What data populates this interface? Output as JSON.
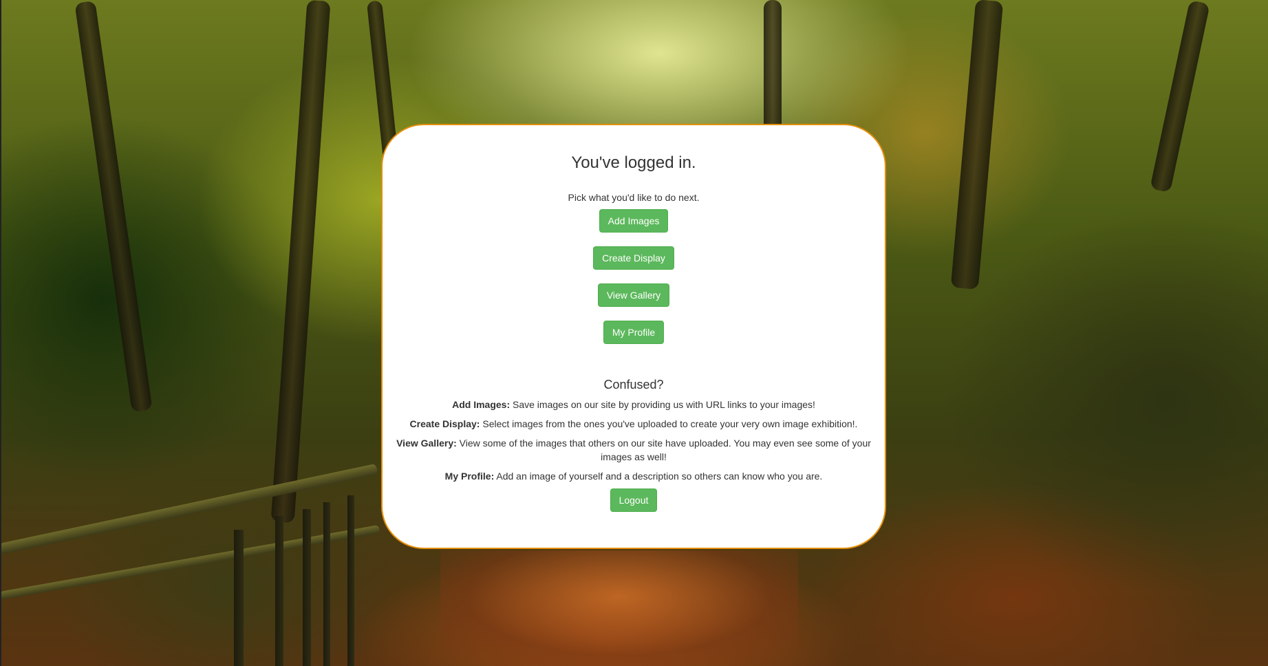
{
  "page": {
    "title": "You've logged in.",
    "subtitle": "Pick what you'd like to do next."
  },
  "actions": [
    {
      "label": "Add Images"
    },
    {
      "label": "Create Display"
    },
    {
      "label": "View Gallery"
    },
    {
      "label": "My Profile"
    }
  ],
  "help": {
    "title": "Confused?",
    "items": [
      {
        "term": "Add Images:",
        "description": "Save images on our site by providing us with URL links to your images!"
      },
      {
        "term": "Create Display:",
        "description": "Select images from the ones you've uploaded to create your very own image exhibition!."
      },
      {
        "term": "View Gallery:",
        "description": "View some of the images that others on our site have uploaded. You may even see some of your images as well!"
      },
      {
        "term": "My Profile:",
        "description": "Add an image of yourself and a description so others can know who you are."
      }
    ]
  },
  "logout": {
    "label": "Logout"
  },
  "colors": {
    "button": "#5cb85c",
    "card_border": "#e58e0a",
    "card_background": "#ffffff",
    "text": "#333333"
  }
}
